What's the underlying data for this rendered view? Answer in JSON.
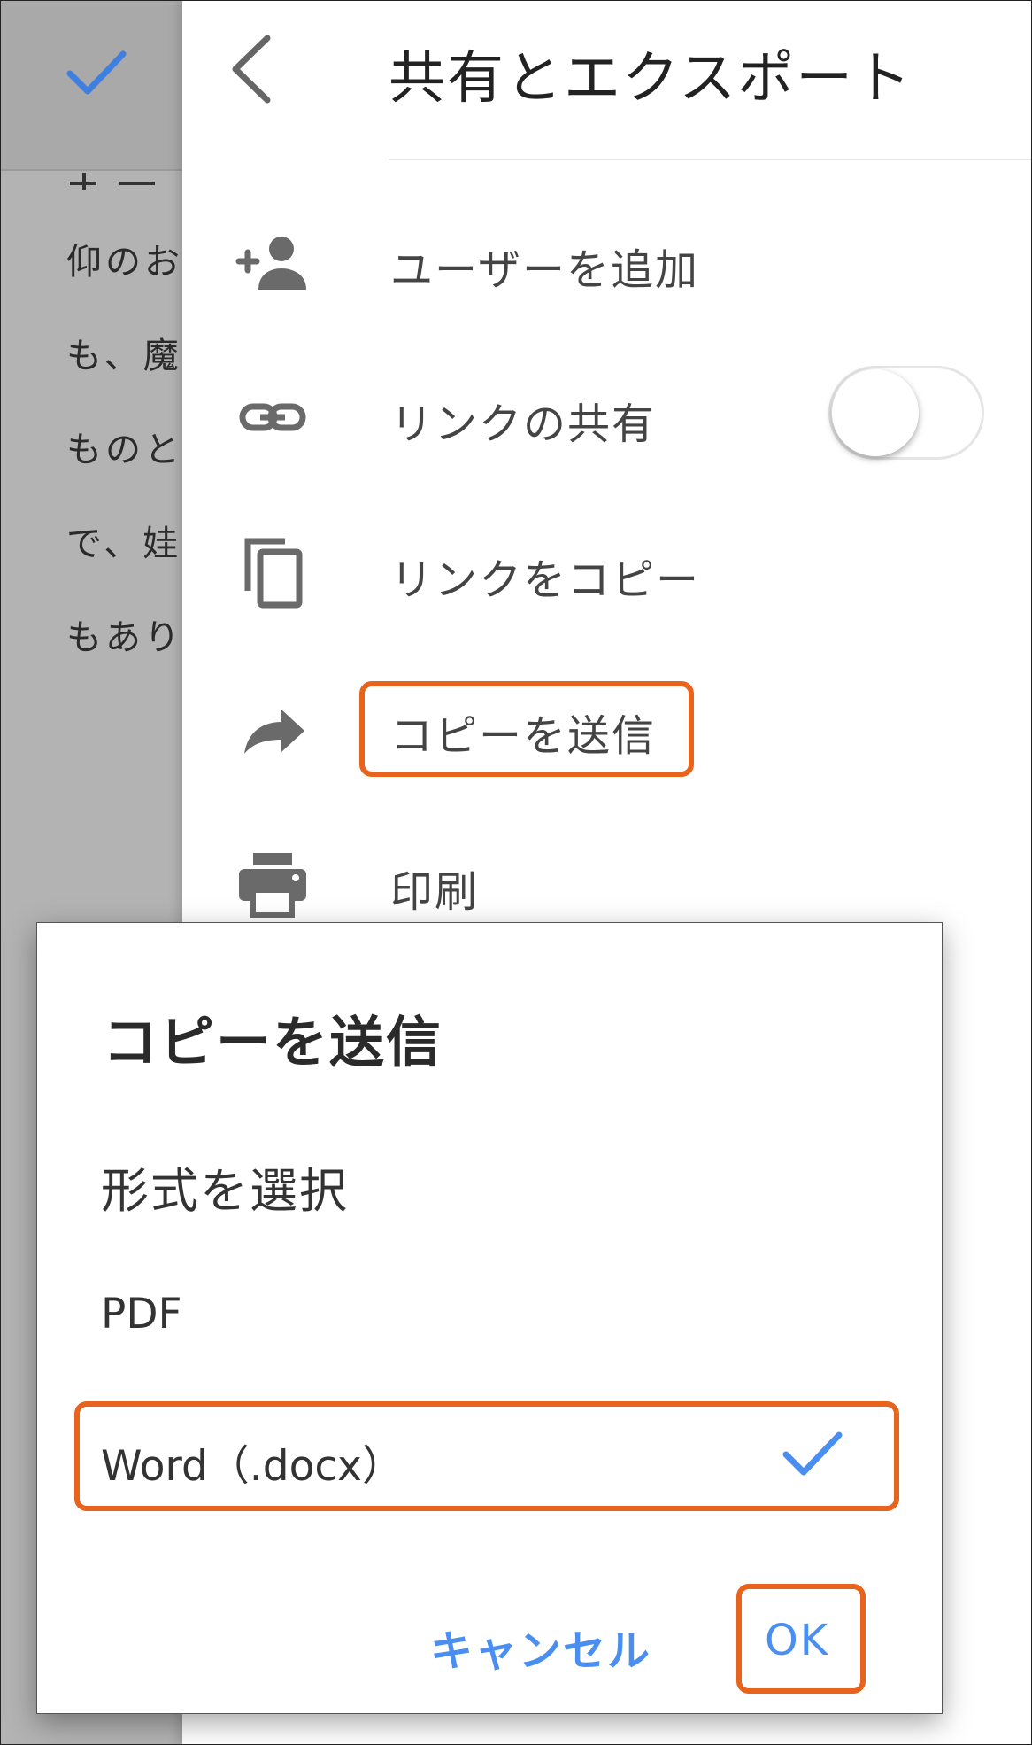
{
  "document": {
    "lines": [
      "",
      "仰のお",
      "も、魔",
      "ものと",
      "で、娃",
      "もあり"
    ]
  },
  "panel": {
    "title": "共有とエクスポート",
    "items": [
      {
        "label": "ユーザーを追加",
        "icon": "add-person-icon"
      },
      {
        "label": "リンクの共有",
        "icon": "link-icon"
      },
      {
        "label": "リンクをコピー",
        "icon": "copy-icon"
      },
      {
        "label": "コピーを送信",
        "icon": "forward-arrow-icon"
      },
      {
        "label": "印刷",
        "icon": "printer-icon"
      }
    ],
    "link_sharing_enabled": false
  },
  "dialog": {
    "title": "コピーを送信",
    "subtitle": "形式を選択",
    "options": [
      {
        "label": "PDF",
        "selected": false
      },
      {
        "label": "Word（.docx）",
        "selected": true
      }
    ],
    "cancel_label": "キャンセル",
    "ok_label": "OK"
  },
  "colors": {
    "accent": "#4a8ff0",
    "highlight": "#e8631c",
    "dim_overlay": "#b3b3b3"
  }
}
